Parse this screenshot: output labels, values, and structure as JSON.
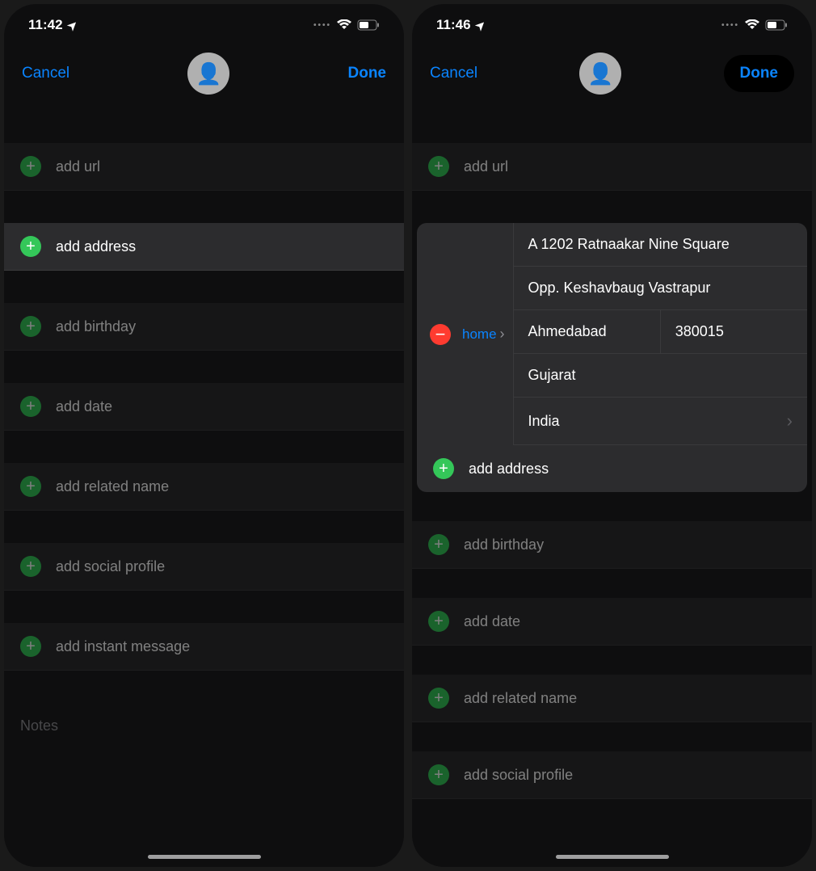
{
  "screen1": {
    "status": {
      "time": "11:42"
    },
    "nav": {
      "cancel": "Cancel",
      "done": "Done"
    },
    "rows": {
      "add_url": "add url",
      "add_address": "add address",
      "add_birthday": "add birthday",
      "add_date": "add date",
      "add_related": "add related name",
      "add_social": "add social profile",
      "add_im": "add instant message"
    },
    "notes_placeholder": "Notes"
  },
  "screen2": {
    "status": {
      "time": "11:46"
    },
    "nav": {
      "cancel": "Cancel",
      "done": "Done"
    },
    "rows": {
      "add_url": "add url",
      "add_address": "add address",
      "add_birthday": "add birthday",
      "add_date": "add date",
      "add_related": "add related name",
      "add_social": "add social profile"
    },
    "address": {
      "label": "home",
      "street1": "A 1202 Ratnaakar Nine Square",
      "street2": "Opp. Keshavbaug Vastrapur",
      "city": "Ahmedabad",
      "zip": "380015",
      "state": "Gujarat",
      "country": "India"
    }
  }
}
